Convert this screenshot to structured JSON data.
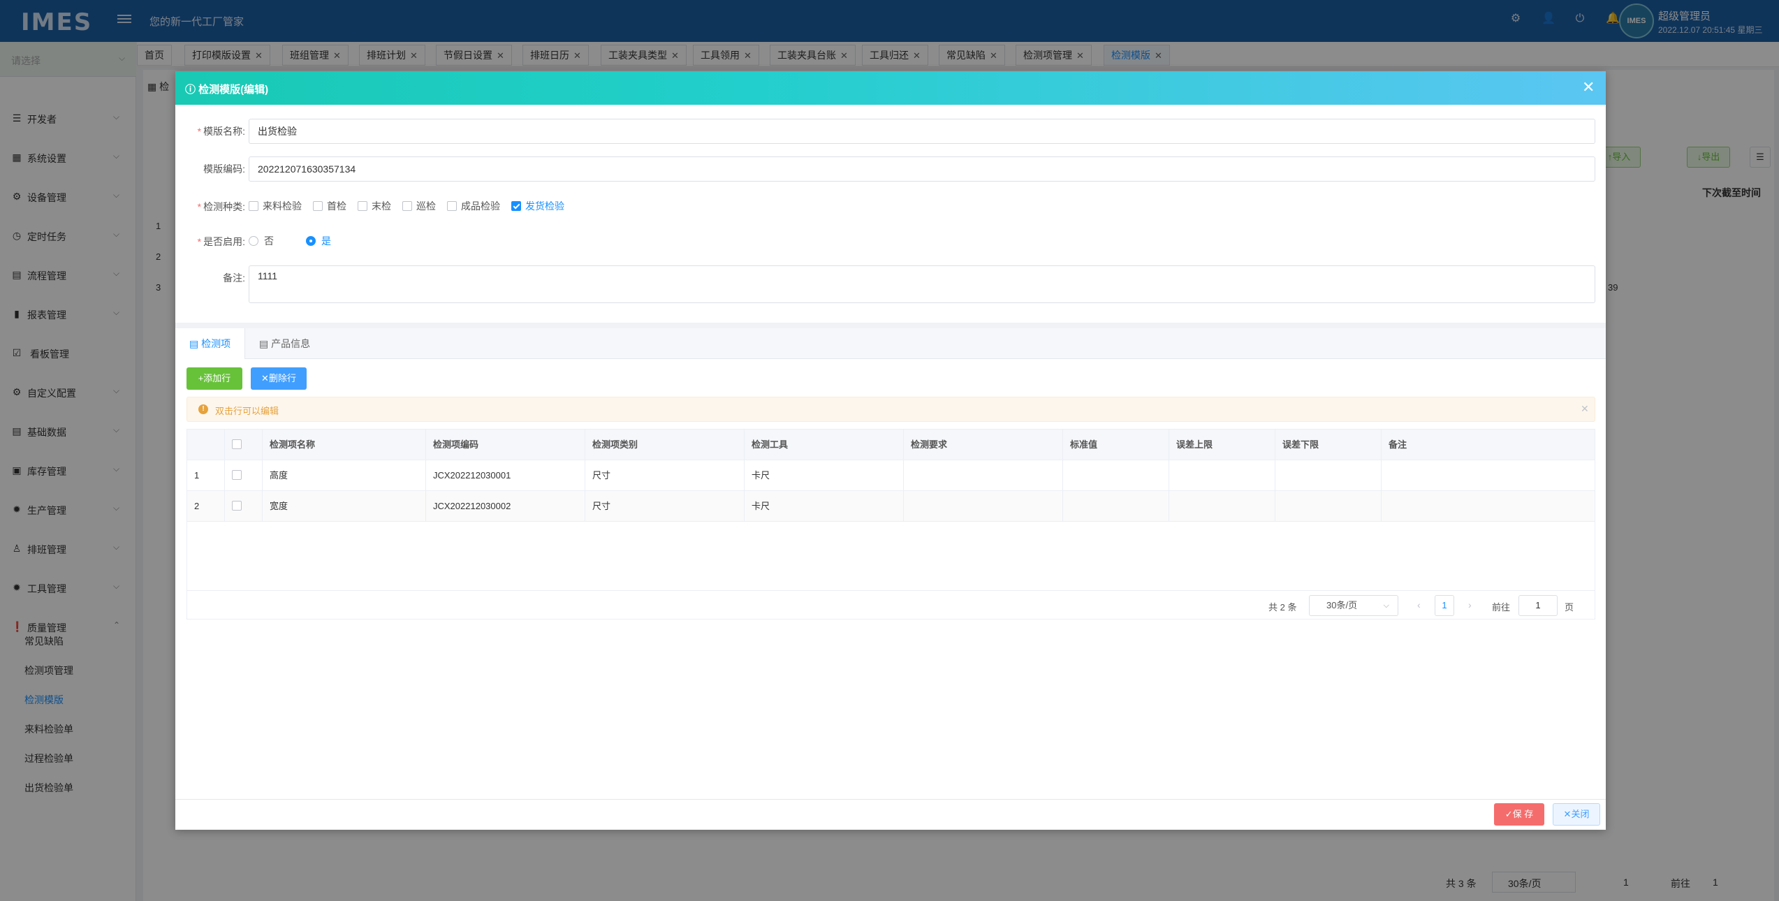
{
  "header": {
    "logo": "IMES",
    "slogan": "您的新一代工厂管家",
    "avatar_text": "IMES",
    "user_name": "超级管理员",
    "datetime": "2022.12.07 20:51:45 星期三"
  },
  "sidebar": {
    "select_placeholder": "请选择",
    "items": [
      {
        "label": "开发者",
        "icon": "sliders-icon"
      },
      {
        "label": "系统设置",
        "icon": "grid-icon"
      },
      {
        "label": "设备管理",
        "icon": "gear-icon"
      },
      {
        "label": "定时任务",
        "icon": "clock-icon"
      },
      {
        "label": "流程管理",
        "icon": "flow-icon"
      },
      {
        "label": "报表管理",
        "icon": "chart-icon"
      },
      {
        "label": "看板管理",
        "icon": "checkbox-icon"
      },
      {
        "label": "自定义配置",
        "icon": "settings-icon"
      },
      {
        "label": "基础数据",
        "icon": "list-icon"
      },
      {
        "label": "库存管理",
        "icon": "box-icon"
      },
      {
        "label": "生产管理",
        "icon": "cog-icon"
      },
      {
        "label": "排班管理",
        "icon": "user-icon"
      },
      {
        "label": "工具管理",
        "icon": "tool-icon"
      },
      {
        "label": "质量管理",
        "icon": "alert-icon"
      }
    ],
    "sub_items": [
      "常见缺陷",
      "检测项管理",
      "检测模版",
      "来料检验单",
      "过程检验单",
      "出货检验单"
    ]
  },
  "tabs": [
    {
      "label": "首页"
    },
    {
      "label": "打印模版设置"
    },
    {
      "label": "班组管理"
    },
    {
      "label": "排班计划"
    },
    {
      "label": "节假日设置"
    },
    {
      "label": "排班日历"
    },
    {
      "label": "工装夹具类型"
    },
    {
      "label": "工具领用"
    },
    {
      "label": "工装夹具台账"
    },
    {
      "label": "工具归还"
    },
    {
      "label": "常见缺陷"
    },
    {
      "label": "检测项管理"
    },
    {
      "label": "检测模版"
    }
  ],
  "background": {
    "title": "检",
    "import_label": "导入",
    "export_label": "导出",
    "col_next_due": "下次截至时间",
    "row_nums": [
      "1",
      "2",
      "3"
    ],
    "partial_value": "39",
    "total": "共 3 条",
    "page_size": "30条/页",
    "page": "1",
    "goto": "前往",
    "goto_page": "1"
  },
  "modal": {
    "title": "检测模版(编辑)",
    "fields": {
      "name_label": "模版名称:",
      "name_value": "出货检验",
      "code_label": "模版编码:",
      "code_value": "202212071630357134",
      "types_label": "检测种类:",
      "types": [
        {
          "label": "来料检验",
          "checked": false
        },
        {
          "label": "首检",
          "checked": false
        },
        {
          "label": "末检",
          "checked": false
        },
        {
          "label": "巡检",
          "checked": false
        },
        {
          "label": "成品检验",
          "checked": false
        },
        {
          "label": "发货检验",
          "checked": true
        }
      ],
      "enabled_label": "是否启用:",
      "enabled_options": [
        {
          "label": "否",
          "checked": false
        },
        {
          "label": "是",
          "checked": true
        }
      ],
      "remark_label": "备注:",
      "remark_value": "1111"
    },
    "inner_tabs": [
      "检测项",
      "产品信息"
    ],
    "add_row": "添加行",
    "delete_row": "删除行",
    "alert": "双击行可以编辑",
    "table": {
      "headers": [
        "检测项名称",
        "检测项编码",
        "检测项类别",
        "检测工具",
        "检测要求",
        "标准值",
        "误差上限",
        "误差下限",
        "备注"
      ],
      "rows": [
        {
          "no": "1",
          "name": "高度",
          "code": "JCX202212030001",
          "type": "尺寸",
          "tool": "卡尺"
        },
        {
          "no": "2",
          "name": "宽度",
          "code": "JCX202212030002",
          "type": "尺寸",
          "tool": "卡尺"
        }
      ]
    },
    "pager": {
      "total": "共 2 条",
      "page_size": "30条/页",
      "page": "1",
      "goto": "前往",
      "goto_page": "1",
      "unit": "页"
    },
    "save": "保 存",
    "close": "关闭"
  }
}
